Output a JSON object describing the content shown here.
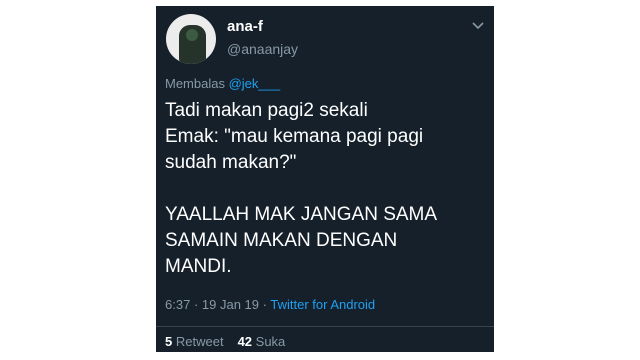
{
  "tweet": {
    "display_name": "ana-f",
    "handle": "@anaanjay",
    "reply_prefix": "Membalas",
    "reply_mention": "@jek___",
    "text": "Tadi makan pagi2 sekali\nEmak: \"mau kemana pagi pagi\nsudah makan?\"\n\nYAALLAH MAK JANGAN SAMA\nSAMAIN MAKAN DENGAN\nMANDI.",
    "time": "6:37",
    "date": "19 Jan 19",
    "separator": "·",
    "source": "Twitter for Android",
    "retweets_count": "5",
    "retweets_label": "Retweet",
    "likes_count": "42",
    "likes_label": "Suka"
  },
  "icons": {
    "menu": "chevron-down-icon",
    "avatar": "profile-photo"
  },
  "colors": {
    "background": "#15202b",
    "text": "#ffffff",
    "secondary": "#8899a6",
    "accent": "#1da1f2",
    "divider": "#38444d"
  }
}
